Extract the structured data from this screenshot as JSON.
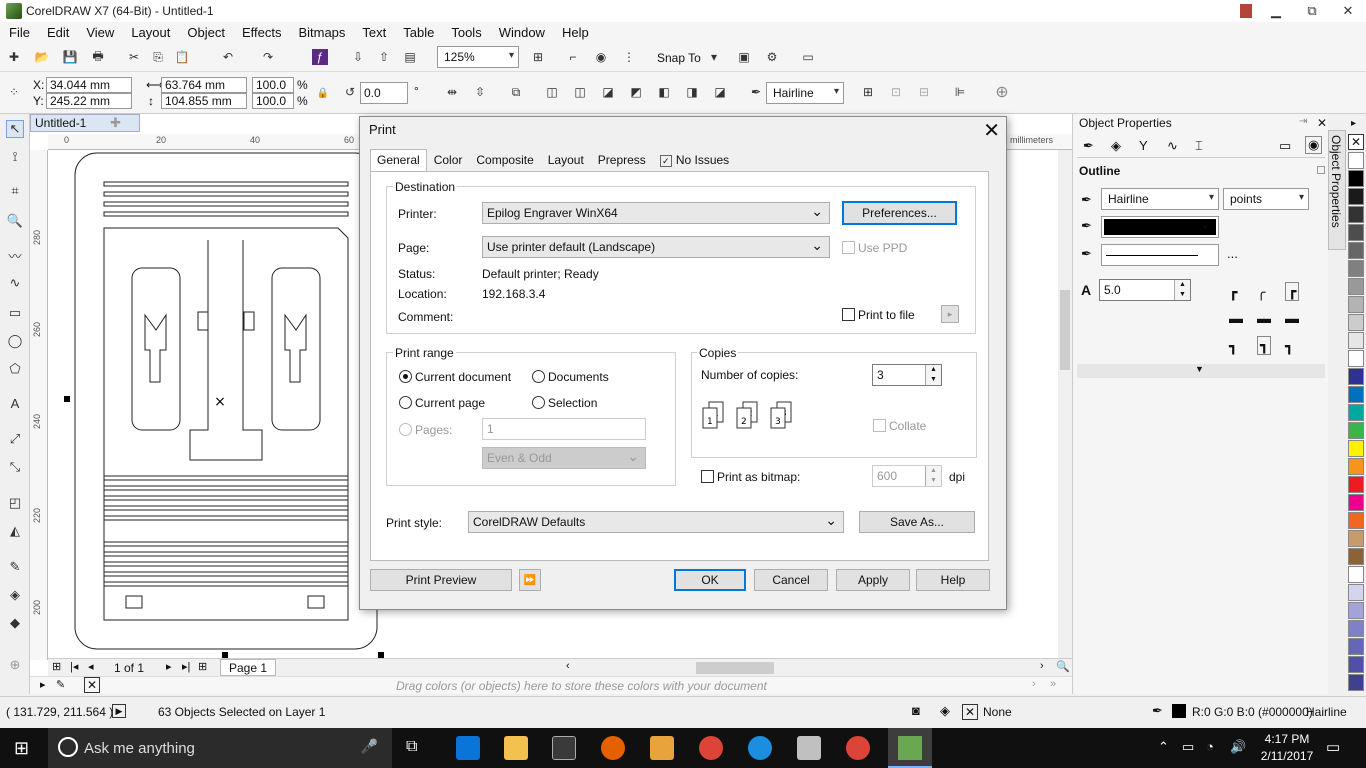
{
  "window": {
    "title": "CorelDRAW X7 (64-Bit) - Untitled-1",
    "controls": [
      "▁",
      "⧉",
      "✕"
    ]
  },
  "menu": [
    "File",
    "Edit",
    "View",
    "Layout",
    "Object",
    "Effects",
    "Bitmaps",
    "Text",
    "Table",
    "Tools",
    "Window",
    "Help"
  ],
  "toolbar": {
    "zoom": "125%",
    "snap_to": "Snap To"
  },
  "propbar": {
    "x_label": "X:",
    "x_value": "34.044 mm",
    "y_label": "Y:",
    "y_value": "245.22 mm",
    "w_value": "63.764 mm",
    "h_value": "104.855 mm",
    "scale_w": "100.0",
    "scale_h": "100.0",
    "pct1": "%",
    "pct2": "%",
    "rotation": "0.0",
    "deg": "°",
    "outline": "Hairline"
  },
  "document": {
    "tab": "Untitled-1",
    "ruler_unit": "millimeters",
    "hruler_ticks": [
      "0",
      "20",
      "40",
      "60"
    ],
    "vruler_ticks": [
      "280",
      "260",
      "240",
      "220",
      "200"
    ],
    "page_count": "1 of 1",
    "page_tab": "Page 1"
  },
  "colordrop": {
    "hint": "Drag colors (or objects) here to store these colors with your document"
  },
  "docker": {
    "title": "Object Properties",
    "section": "Outline",
    "outline_width": "Hairline",
    "units": "points",
    "miter": "5.0",
    "more": "...",
    "side_tab": "Object Properties"
  },
  "palette": {
    "colors": [
      "#ffffff",
      "#000000",
      "#1a1a1a",
      "#333333",
      "#4d4d4d",
      "#666666",
      "#808080",
      "#999999",
      "#b3b3b3",
      "#cccccc",
      "#e6e6e6",
      "#ffffff",
      "#2e3192",
      "#0071bc",
      "#00a99d",
      "#39b54a",
      "#fff200",
      "#f7941d",
      "#ed1c24",
      "#ec008c",
      "#f26522",
      "#c69c6d",
      "#8c6239",
      "#ffffff",
      "#d4d4f0",
      "#a3a3d9",
      "#8080c8",
      "#6666b8",
      "#5050a8",
      "#404090"
    ]
  },
  "statusbar": {
    "coords": "( 131.729, 211.564 )",
    "selection": "63 Objects Selected on Layer 1",
    "fill": "None",
    "outline_color": "R:0 G:0 B:0 (#000000)",
    "outline_width": "Hairline"
  },
  "taskbar": {
    "search_placeholder": "Ask me anything",
    "time": "4:17 PM",
    "date": "2/11/2017"
  },
  "dialog": {
    "title": "Print",
    "tabs": [
      "General",
      "Color",
      "Composite",
      "Layout",
      "Prepress",
      "No Issues"
    ],
    "destination": {
      "title": "Destination",
      "printer_label": "Printer:",
      "printer": "Epilog Engraver WinX64",
      "preferences": "Preferences...",
      "page_label": "Page:",
      "page": "Use printer default (Landscape)",
      "use_ppd": "Use PPD",
      "status_label": "Status:",
      "status": "Default printer; Ready",
      "location_label": "Location:",
      "location": "192.168.3.4",
      "comment_label": "Comment:",
      "print_to_file": "Print to file"
    },
    "print_range": {
      "title": "Print range",
      "current_document": "Current document",
      "documents": "Documents",
      "current_page": "Current page",
      "selection": "Selection",
      "pages_label": "Pages:",
      "pages_value": "1",
      "even_odd": "Even & Odd"
    },
    "copies": {
      "title": "Copies",
      "number_label": "Number of copies:",
      "number": "3",
      "collate": "Collate"
    },
    "bitmap": {
      "label": "Print as bitmap:",
      "dpi_value": "600",
      "dpi_unit": "dpi"
    },
    "style": {
      "label": "Print style:",
      "value": "CorelDRAW Defaults",
      "save_as": "Save As..."
    },
    "buttons": {
      "preview": "Print Preview",
      "ok": "OK",
      "cancel": "Cancel",
      "apply": "Apply",
      "help": "Help"
    }
  }
}
